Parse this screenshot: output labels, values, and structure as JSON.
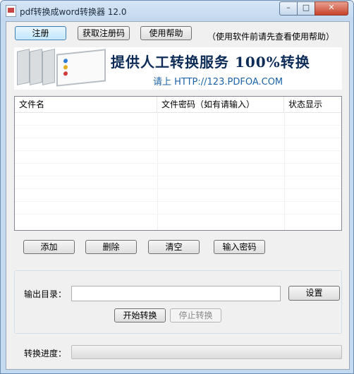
{
  "window": {
    "title": "pdf转换成word转换器 12.0",
    "controls": {
      "minimize": "–",
      "maximize": "□",
      "close": "✕"
    }
  },
  "toolbar": {
    "register": "注册",
    "get_code": "获取注册码",
    "help": "使用帮助",
    "hint": "（使用软件前请先查看使用帮助）"
  },
  "banner": {
    "headline": "提供人工转换服务 100%转换",
    "sub": "请上  HTTP://123.PDFOA.COM",
    "colors": {
      "headline": "#0d2b57",
      "sub": "#1d63a8"
    }
  },
  "file_list": {
    "columns": [
      "文件名",
      "文件密码（如有请输入）",
      "状态显示"
    ],
    "rows": []
  },
  "list_actions": {
    "add": "添加",
    "delete": "删除",
    "clear": "清空",
    "password": "输入密码"
  },
  "output": {
    "dir_label": "输出目录：",
    "dir_value": "",
    "settings": "设置",
    "start": "开始转换",
    "stop": "停止转换"
  },
  "progress": {
    "label": "转换进度：",
    "value": 0
  }
}
